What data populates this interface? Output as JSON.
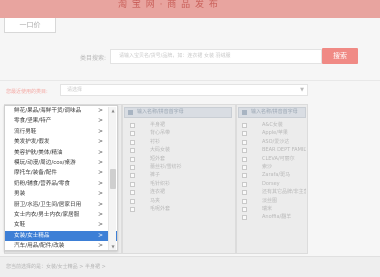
{
  "header": {
    "banner_text": "淘 宝 网   ·   商 品 发 布",
    "back_tab": "一口价"
  },
  "search": {
    "label": "类目搜索:",
    "placeholder": "请输入宝贝名/货号/品牌，如：连衣裙 女装 羽绒服",
    "button": "搜索"
  },
  "category": {
    "label": "您最近使用的类目:",
    "selected": "请选择"
  },
  "panels": {
    "middle_header": "输入名称/拼音首字母",
    "right_header": "输入名称/拼音首字母",
    "middle_items": [
      "半身裙",
      "背心吊带",
      "衬衫",
      "大码女装",
      "短外套",
      "蕾丝衫/雪纺衫",
      "裤子",
      "毛针织衫",
      "连衣裙",
      "马夹",
      "毛呢外套"
    ],
    "right_items": [
      "A&C女装",
      "Apple/苹果",
      "ASO/爱沙达",
      "BEAR DEPT FAMILY/熊之家",
      "CLEVA/可丽尔",
      "索沙",
      "Zarafa/斑马",
      "Dorsey",
      "还有其它品牌/非主营品牌",
      "淡丝图",
      "瑞米",
      "Anoffia/翻羊"
    ]
  },
  "dropdown": {
    "items": [
      {
        "label": "鲜花/果品/海鲜干货/调味品",
        "selected": false
      },
      {
        "label": "零食/坚果/特产",
        "selected": false
      },
      {
        "label": "流行男鞋",
        "selected": false
      },
      {
        "label": "美发护发/假发",
        "selected": false
      },
      {
        "label": "美容护肤/美体/精油",
        "selected": false
      },
      {
        "label": "模玩/动漫/周边/cos/桌游",
        "selected": false
      },
      {
        "label": "摩托车/装备/配件",
        "selected": false
      },
      {
        "label": "奶粉/辅食/营养品/零食",
        "selected": false
      },
      {
        "label": "男装",
        "selected": false
      },
      {
        "label": "厨卫/水浴/卫生间/居家日用",
        "selected": false
      },
      {
        "label": "女士内衣/男士内衣/家居服",
        "selected": false
      },
      {
        "label": "女鞋",
        "selected": false
      },
      {
        "label": "女装/女士精品",
        "selected": true
      },
      {
        "label": "汽车/用品/配件/改装",
        "selected": false
      }
    ],
    "arrow_glyph": ">"
  },
  "footer": {
    "text": "您当前选择的是：女装/女士精品 > 半身裙 >"
  }
}
